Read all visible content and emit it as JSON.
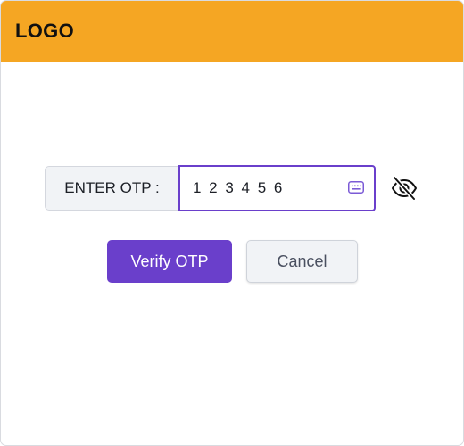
{
  "header": {
    "logo_text": "LOGO",
    "background_color": "#f5a623"
  },
  "otp": {
    "label": "ENTER OTP :",
    "value": "1 2 3 4 5 6",
    "input_icon": "keyboard-icon",
    "visibility_toggle_icon": "eye-off-icon",
    "focus_color": "#6a3fcb"
  },
  "actions": {
    "verify_label": "Verify OTP",
    "cancel_label": "Cancel",
    "primary_color": "#6a3fcb"
  }
}
